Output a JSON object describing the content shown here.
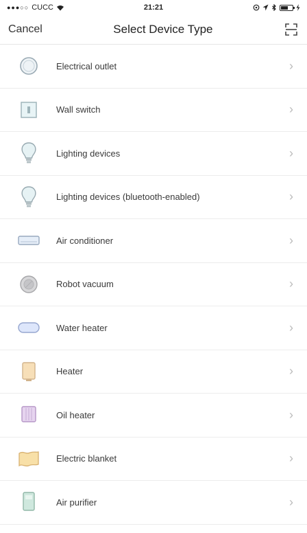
{
  "status_bar": {
    "signal_dots": "●●●○○",
    "carrier": "CUCC",
    "time": "21:21"
  },
  "nav": {
    "cancel_label": "Cancel",
    "title": "Select Device Type"
  },
  "devices": [
    {
      "label": "Electrical outlet",
      "icon": "outlet-icon"
    },
    {
      "label": "Wall switch",
      "icon": "wall-switch-icon"
    },
    {
      "label": "Lighting devices",
      "icon": "light-bulb-icon"
    },
    {
      "label": "Lighting devices (bluetooth-enabled)",
      "icon": "light-bulb-icon"
    },
    {
      "label": "Air conditioner",
      "icon": "air-conditioner-icon"
    },
    {
      "label": "Robot vacuum",
      "icon": "robot-vacuum-icon"
    },
    {
      "label": "Water heater",
      "icon": "water-heater-icon"
    },
    {
      "label": "Heater",
      "icon": "heater-icon"
    },
    {
      "label": "Oil heater",
      "icon": "oil-heater-icon"
    },
    {
      "label": "Electric blanket",
      "icon": "electric-blanket-icon"
    },
    {
      "label": "Air purifier",
      "icon": "air-purifier-icon"
    }
  ],
  "chevron": "›"
}
